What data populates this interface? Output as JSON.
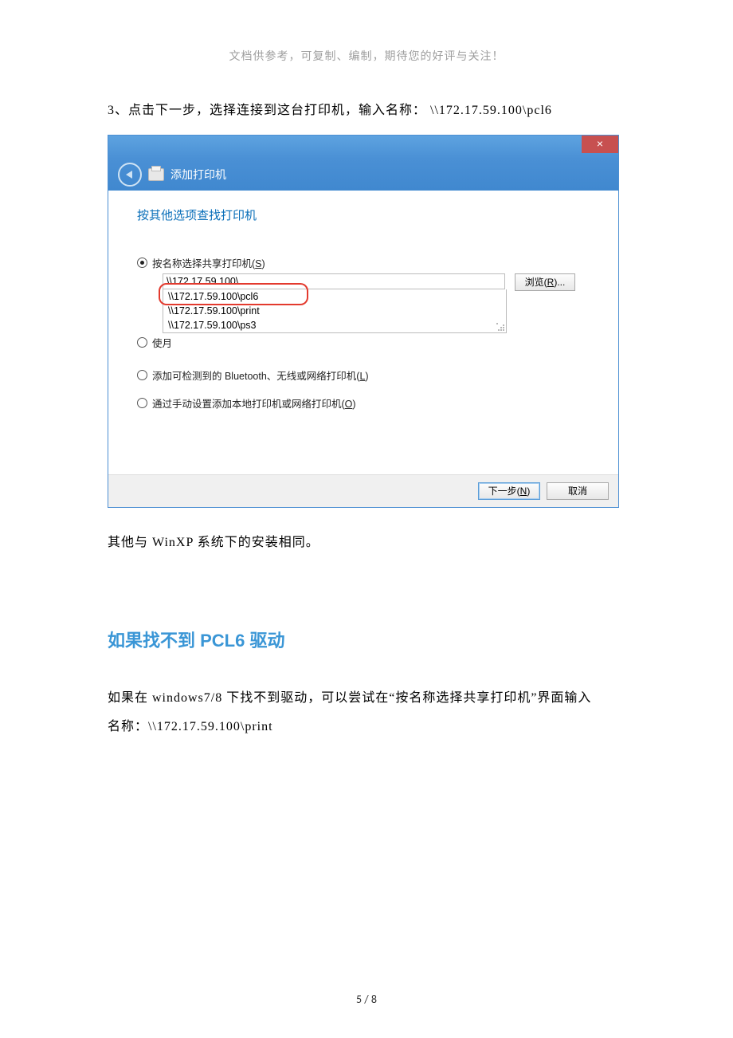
{
  "header_note": "文档供参考，可复制、编制，期待您的好评与关注！",
  "paragraph_step": "3、点击下一步，选择连接到这台打印机，输入名称： \\\\172.17.59.100\\pcl6",
  "dialog": {
    "close_glyph": "×",
    "nav_title": "添加打印机",
    "subtitle": "按其他选项查找打印机",
    "opt1_prefix": "按名称选择共享打印机(",
    "opt1_key": "S",
    "opt1_suffix": ")",
    "input_value": "\\\\172.17.59.100\\",
    "browse_prefix": "浏览(",
    "browse_key": "R",
    "browse_suffix": ")...",
    "dropdown": {
      "item1": "\\\\172.17.59.100\\pcl6",
      "item2": "\\\\172.17.59.100\\print",
      "item3": "\\\\172.17.59.100\\ps3"
    },
    "opt2_label": "使月",
    "opt3_prefix": "添加可检测到的 Bluetooth、无线或网络打印机(",
    "opt3_key": "L",
    "opt3_suffix": ")",
    "opt4_prefix": "通过手动设置添加本地打印机或网络打印机(",
    "opt4_key": "O",
    "opt4_suffix": ")",
    "next_prefix": "下一步(",
    "next_key": "N",
    "next_suffix": ")",
    "cancel_label": "取消"
  },
  "after_dialog_text": "其他与 WinXP 系统下的安装相同。",
  "section_heading": "如果找不到 PCL6 驱动",
  "pcl6_para1": "如果在 windows7/8 下找不到驱动，可以尝试在“按名称选择共享打印机”界面输入",
  "pcl6_para2": "名称：\\\\172.17.59.100\\print",
  "pager": "5 / 8"
}
